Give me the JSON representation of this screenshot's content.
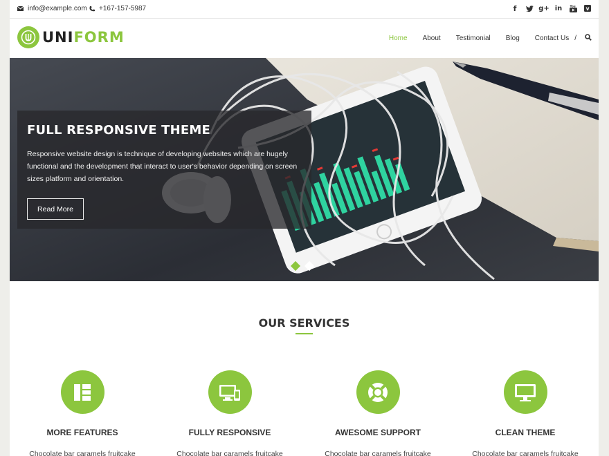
{
  "topbar": {
    "email": "info@example.com",
    "phone": "+167-157-5987",
    "social_icons": [
      "facebook-icon",
      "twitter-icon",
      "google-plus-icon",
      "linkedin-icon",
      "youtube-icon",
      "vimeo-icon"
    ]
  },
  "brand": {
    "logo_part1": "UNI",
    "logo_part2": "FORM",
    "accent_color": "#8cc63e"
  },
  "nav": {
    "items": [
      {
        "label": "Home",
        "active": true
      },
      {
        "label": "About",
        "active": false
      },
      {
        "label": "Testimonial",
        "active": false
      },
      {
        "label": "Blog",
        "active": false
      },
      {
        "label": "Contact Us",
        "active": false
      }
    ],
    "separator": "/"
  },
  "hero": {
    "title": "FULL RESPONSIVE THEME",
    "text": "Responsive website design is technique of developing websites which are hugely functional and the development that interact to user's behavior depending on screen sizes platform and orientation.",
    "button_label": "Read More",
    "slides": [
      {
        "active": true,
        "color": "#8cc63e"
      },
      {
        "active": false,
        "color": "#ffffff"
      }
    ]
  },
  "services": {
    "title": "OUR SERVICES",
    "items": [
      {
        "title": "MORE FEATURES",
        "text": "Chocolate bar caramels fruitcake",
        "icon": "sitemap-icon"
      },
      {
        "title": "FULLY RESPONSIVE",
        "text": "Chocolate bar caramels fruitcake",
        "icon": "devices-icon"
      },
      {
        "title": "AWESOME SUPPORT",
        "text": "Chocolate bar caramels fruitcake",
        "icon": "lifebuoy-icon"
      },
      {
        "title": "CLEAN THEME",
        "text": "Chocolate bar caramels fruitcake",
        "icon": "monitor-icon"
      }
    ]
  }
}
